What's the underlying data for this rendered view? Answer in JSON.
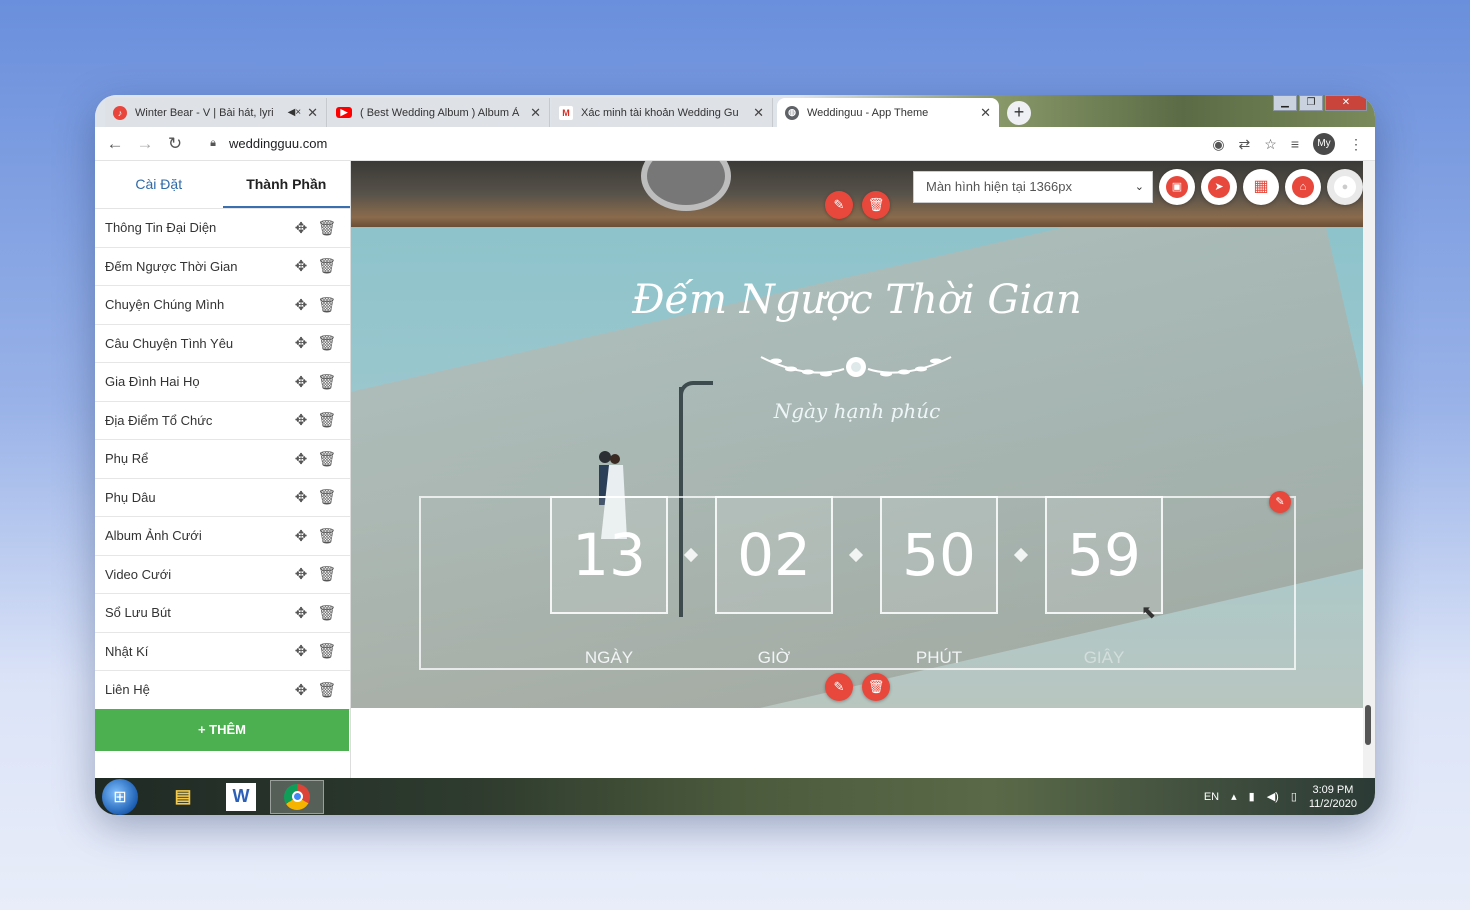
{
  "browser": {
    "tabs": [
      {
        "title": "Winter Bear - V | Bài hát, lyri",
        "favicon": "music-icon",
        "color": "#e8453c",
        "muted": true
      },
      {
        "title": "( Best Wedding Album ) Album Ả",
        "favicon": "youtube-icon",
        "color": "#ff0000"
      },
      {
        "title": "Xác minh tài khoản Wedding Gu",
        "favicon": "gmail-icon",
        "color": "#d93025"
      },
      {
        "title": "Weddinguu - App Theme",
        "favicon": "globe-icon",
        "color": "#5f6368",
        "active": true
      }
    ],
    "new_tab": "+",
    "url": "weddingguu.com",
    "profile": "My"
  },
  "sidebar": {
    "tabs": [
      "Cài Đặt",
      "Thành Phần"
    ],
    "active_tab": 1,
    "items": [
      "Thông Tin Đại Diện",
      "Đếm Ngược Thời Gian",
      "Chuyện Chúng Mình",
      "Câu Chuyện Tình Yêu",
      "Gia Đình Hai Họ",
      "Địa Điểm Tổ Chức",
      "Phụ Rể",
      "Phụ Dâu",
      "Album Ảnh Cưới",
      "Video Cưới",
      "Sổ Lưu Bút",
      "Nhật Kí",
      "Liên Hệ"
    ],
    "add_label": "+ THÊM"
  },
  "toolbar": {
    "screen_select": "Màn hình hiện tại 1366px"
  },
  "countdown": {
    "title": "Đếm Ngược Thời Gian",
    "subtitle": "Ngày hạnh phúc",
    "units": [
      {
        "value": "13",
        "label": "NGÀY"
      },
      {
        "value": "02",
        "label": "GIỜ"
      },
      {
        "value": "50",
        "label": "PHÚT"
      },
      {
        "value": "59",
        "label": "GIÂY"
      }
    ]
  },
  "taskbar": {
    "lang": "EN",
    "time": "3:09 PM",
    "date": "11/2/2020"
  },
  "colors": {
    "accent_red": "#e8483c",
    "add_green": "#4caf50",
    "tab_blue": "#2f6aa8"
  }
}
